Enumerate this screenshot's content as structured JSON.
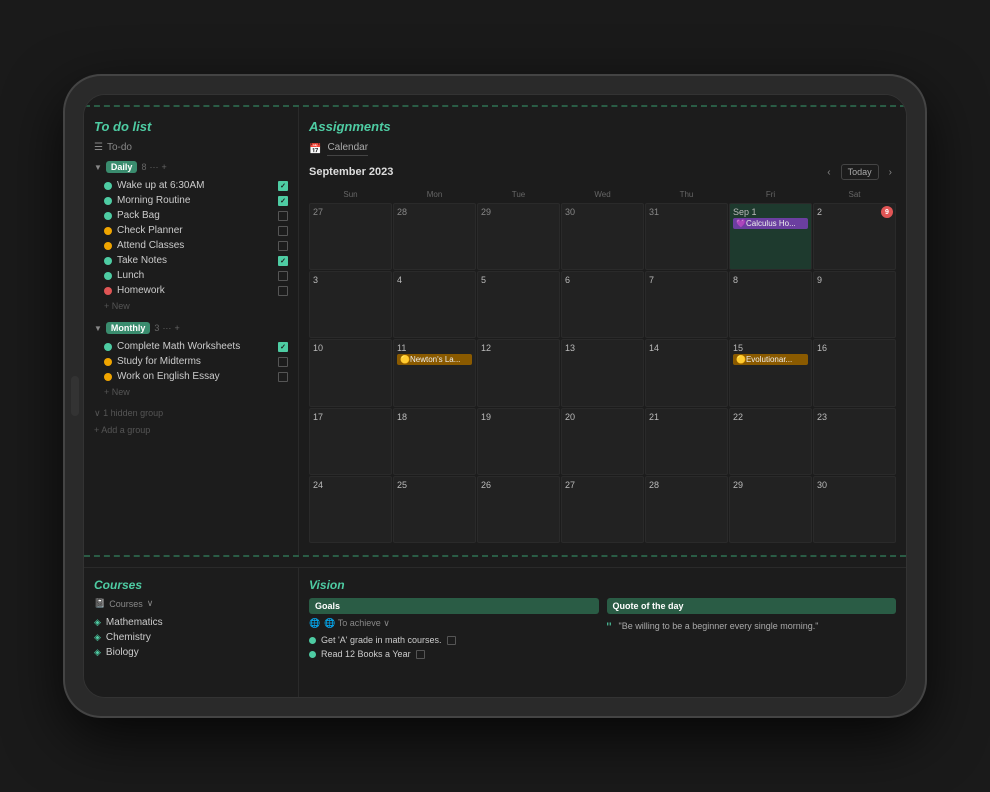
{
  "device": {
    "background": "#1a1a1a"
  },
  "todo": {
    "title": "To do list",
    "toolbar_label": "To-do",
    "daily_group": {
      "label": "Daily",
      "count": "8",
      "items": [
        {
          "text": "Wake up at 6:30AM",
          "dot": "green",
          "checked": true
        },
        {
          "text": "Morning Routine",
          "dot": "green",
          "checked": true
        },
        {
          "text": "Pack Bag",
          "dot": "green",
          "checked": false
        },
        {
          "text": "Check Planner",
          "dot": "orange",
          "checked": false
        },
        {
          "text": "Attend Classes",
          "dot": "orange",
          "checked": false
        },
        {
          "text": "Take Notes",
          "dot": "green",
          "checked": true
        },
        {
          "text": "Lunch",
          "dot": "green",
          "checked": false
        },
        {
          "text": "Homework",
          "dot": "red",
          "checked": false
        }
      ],
      "add_new": "+ New"
    },
    "monthly_group": {
      "label": "Monthly",
      "count": "3",
      "items": [
        {
          "text": "Complete Math Worksheets",
          "dot": "green",
          "checked": true
        },
        {
          "text": "Study for Midterms",
          "dot": "orange",
          "checked": false
        },
        {
          "text": "Work on English Essay",
          "dot": "orange",
          "checked": false
        }
      ],
      "add_new": "+ New"
    },
    "hidden_group": "∨ 1 hidden group",
    "add_group": "+ Add a group"
  },
  "assignments": {
    "title": "Assignments",
    "calendar_label": "Calendar",
    "month_year": "September 2023",
    "today_btn": "Today",
    "day_headers": [
      "Sun",
      "Mon",
      "Tue",
      "Wed",
      "Thu",
      "Fri",
      "Sat"
    ],
    "weeks": [
      [
        {
          "date": "27",
          "current": false,
          "events": []
        },
        {
          "date": "28",
          "current": false,
          "events": []
        },
        {
          "date": "29",
          "current": false,
          "events": []
        },
        {
          "date": "30",
          "current": false,
          "events": []
        },
        {
          "date": "31",
          "current": false,
          "events": []
        },
        {
          "date": "Sep 1",
          "current": true,
          "today": true,
          "events": [
            {
              "text": "💜Calculus Ho...",
              "type": "purple"
            }
          ]
        },
        {
          "date": "2",
          "current": true,
          "badge": "9",
          "events": []
        }
      ],
      [
        {
          "date": "3",
          "current": true,
          "events": []
        },
        {
          "date": "4",
          "current": true,
          "events": []
        },
        {
          "date": "5",
          "current": true,
          "events": []
        },
        {
          "date": "6",
          "current": true,
          "events": []
        },
        {
          "date": "7",
          "current": true,
          "events": []
        },
        {
          "date": "8",
          "current": true,
          "events": []
        },
        {
          "date": "9",
          "current": true,
          "events": []
        }
      ],
      [
        {
          "date": "10",
          "current": true,
          "events": []
        },
        {
          "date": "11",
          "current": true,
          "events": [
            {
              "text": "🟡Newton's La...",
              "type": "orange"
            }
          ]
        },
        {
          "date": "12",
          "current": true,
          "events": []
        },
        {
          "date": "13",
          "current": true,
          "events": []
        },
        {
          "date": "14",
          "current": true,
          "events": []
        },
        {
          "date": "15",
          "current": true,
          "events": [
            {
              "text": "🟡Evolutionar...",
              "type": "orange"
            }
          ]
        },
        {
          "date": "16",
          "current": true,
          "events": []
        }
      ],
      [
        {
          "date": "17",
          "current": true,
          "events": []
        },
        {
          "date": "18",
          "current": true,
          "events": []
        },
        {
          "date": "19",
          "current": true,
          "events": []
        },
        {
          "date": "20",
          "current": true,
          "events": []
        },
        {
          "date": "21",
          "current": true,
          "events": []
        },
        {
          "date": "22",
          "current": true,
          "events": []
        },
        {
          "date": "23",
          "current": true,
          "events": []
        }
      ],
      [
        {
          "date": "24",
          "current": true,
          "events": []
        },
        {
          "date": "25",
          "current": true,
          "events": []
        },
        {
          "date": "26",
          "current": true,
          "events": []
        },
        {
          "date": "27",
          "current": true,
          "events": []
        },
        {
          "date": "28",
          "current": true,
          "events": []
        },
        {
          "date": "29",
          "current": true,
          "events": []
        },
        {
          "date": "30",
          "current": true,
          "events": []
        }
      ]
    ]
  },
  "courses": {
    "title": "Courses",
    "toolbar_label": "Courses",
    "items": [
      {
        "name": "Mathematics"
      },
      {
        "name": "Chemistry"
      },
      {
        "name": "Biology"
      }
    ]
  },
  "vision": {
    "title": "Vision",
    "goals_header": "Goals",
    "achieve_label": "🌐 To achieve ∨",
    "goals_items": [
      {
        "text": "Get 'A' grade in math courses."
      },
      {
        "text": "Read 12 Books a Year"
      }
    ],
    "quote_header": "Quote of the day",
    "quote_text": "\"Be willing to be a beginner every single morning.\""
  }
}
